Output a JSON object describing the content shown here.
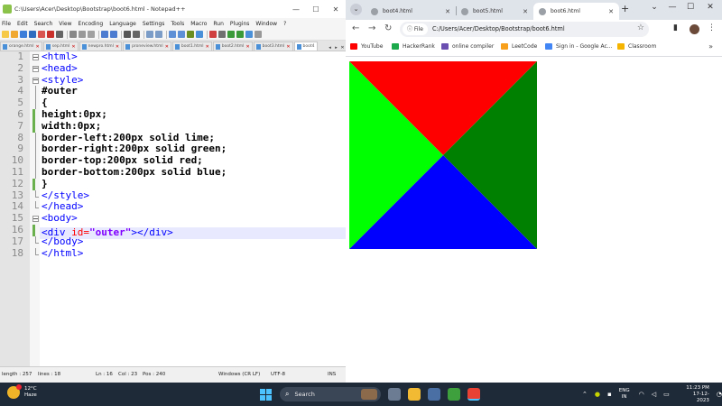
{
  "notepad": {
    "title": "C:\\Users\\Acer\\Desktop\\Bootstrap\\boot6.html - Notepad++",
    "window_controls": [
      "—",
      "☐",
      "✕"
    ],
    "menu": [
      "File",
      "Edit",
      "Search",
      "View",
      "Encoding",
      "Language",
      "Settings",
      "Tools",
      "Macro",
      "Run",
      "Plugins",
      "Window",
      "?"
    ],
    "file_tabs": [
      "orange.html",
      "sep.html",
      "newpro.html",
      "proneview.html",
      "boot1.html",
      "boot2.html",
      "boot3.html",
      "boot4"
    ],
    "tab_arrows": [
      "◂",
      "▸",
      "✕"
    ],
    "line_numbers": [
      "1",
      "2",
      "3",
      "4",
      "5",
      "6",
      "7",
      "8",
      "9",
      "10",
      "11",
      "12",
      "13",
      "14",
      "15",
      "16",
      "17",
      "18"
    ],
    "code_lines": [
      "<html>",
      "<head>",
      "<style>",
      "#outer",
      "{",
      "height:0px;",
      "width:0px;",
      "border-left:200px solid lime;",
      "border-right:200px solid green;",
      "border-top:200px solid red;",
      "border-bottom:200px solid blue;",
      "}",
      "</style>",
      "</head>",
      "<body>",
      "",
      "</body>",
      "</html>"
    ],
    "line16": {
      "open": "<div ",
      "attr": "id=",
      "value": "\"outer\"",
      "close": "></div>"
    },
    "status": {
      "length": "length : 257",
      "lines": "lines : 18",
      "ln": "Ln : 16",
      "col": "Col : 23",
      "pos": "Pos : 240",
      "eol": "Windows (CR LF)",
      "encoding": "UTF-8",
      "mode": "INS"
    }
  },
  "chrome": {
    "dropdown": "⌄",
    "tabs": [
      {
        "title": "boot4.html",
        "close": "✕"
      },
      {
        "title": "boot5.html",
        "close": "✕"
      },
      {
        "title": "boot6.html",
        "close": "✕"
      }
    ],
    "new_tab": "+",
    "window_controls": [
      "⌄",
      "—",
      "☐",
      "✕"
    ],
    "nav": {
      "back": "←",
      "forward": "→",
      "reload": "↻"
    },
    "address": {
      "chip": "ⓘ File",
      "url": "C:/Users/Acer/Desktop/Bootstrap/boot6.html",
      "star": "☆"
    },
    "bookmarks": [
      {
        "label": "YouTube",
        "color": "#ff0000"
      },
      {
        "label": "HackerRank",
        "color": "#1ba94c"
      },
      {
        "label": "online compiler",
        "color": "#6a4fb0"
      },
      {
        "label": "LeetCode",
        "color": "#f89f1b"
      },
      {
        "label": "Sign in - Google Ac...",
        "color": "#4285f4"
      },
      {
        "label": "Classroom",
        "color": "#f4b400"
      }
    ],
    "bookmarks_more": "»",
    "demo_colors": {
      "left": "#00ff00",
      "right": "#008000",
      "top": "#ff0000",
      "bottom": "#0000ff"
    }
  },
  "taskbar": {
    "weather_temp": "12°C",
    "weather_desc": "Haze",
    "search_label": "Search",
    "tray_up": "⌃",
    "lang_1": "ENG",
    "lang_2": "IN",
    "time": "11:23 PM",
    "date": "17-12-2023"
  }
}
